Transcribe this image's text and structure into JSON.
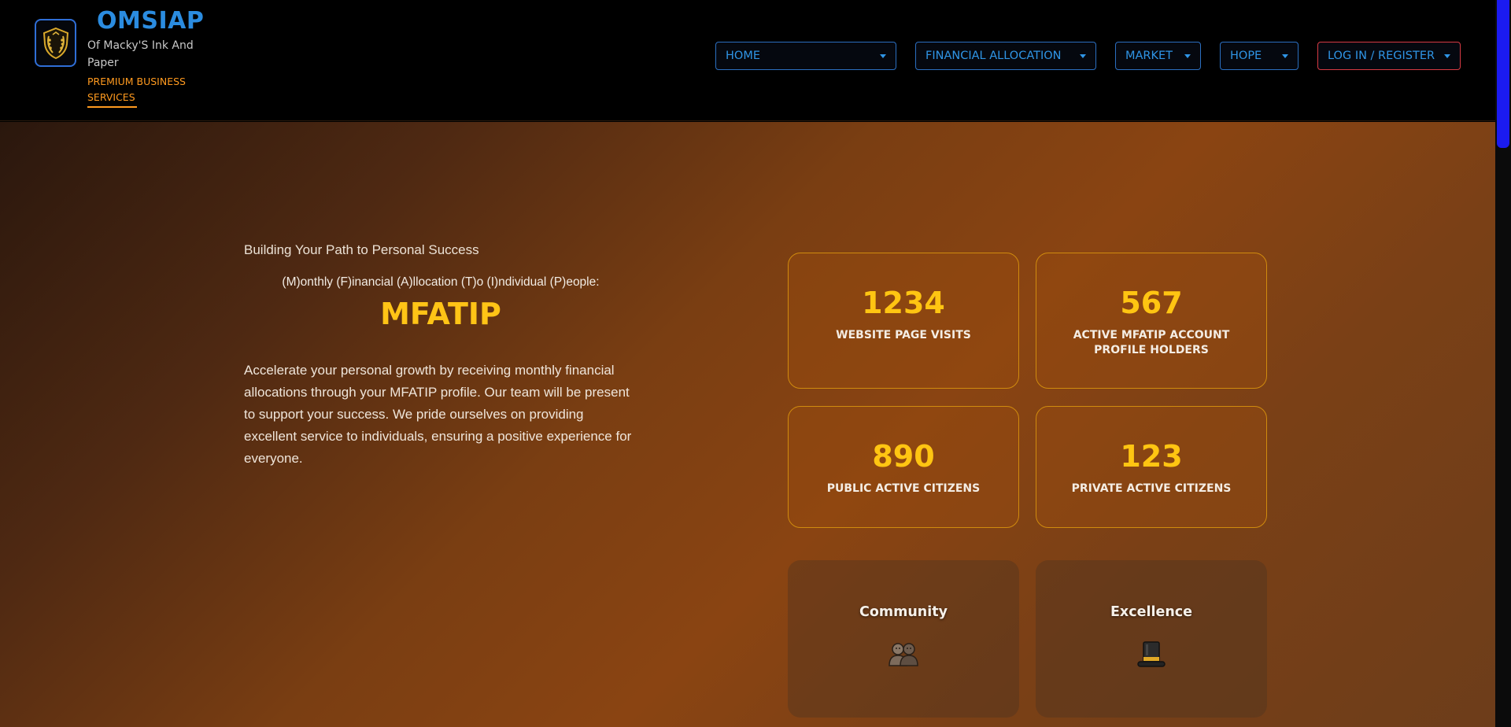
{
  "header": {
    "brand_title": "OMSIAP",
    "brand_subtitle": "Of Macky'S Ink And Paper",
    "brand_tagline": "PREMIUM BUSINESS SERVICES",
    "logo_icon": "shield-laurel-icon",
    "nav": [
      {
        "label": "HOME"
      },
      {
        "label": "FINANCIAL ALLOCATION"
      },
      {
        "label": "MARKET"
      },
      {
        "label": "HOPE"
      },
      {
        "label": "LOG IN / REGISTER"
      }
    ]
  },
  "hero": {
    "tagline": "Building Your Path to Personal Success",
    "acronym": "(M)onthly (F)inancial (A)llocation (T)o (I)ndividual (P)eople:",
    "title": "MFATIP",
    "body": "Accelerate your personal growth by receiving monthly financial allocations through your MFATIP profile. Our team will be present to support your success. We pride ourselves on providing excellent service to individuals, ensuring a positive experience for everyone."
  },
  "stats": [
    {
      "value": "1234",
      "label": "WEBSITE PAGE VISITS"
    },
    {
      "value": "567",
      "label": "ACTIVE MFATIP ACCOUNT PROFILE HOLDERS"
    },
    {
      "value": "890",
      "label": "PUBLIC ACTIVE CITIZENS"
    },
    {
      "value": "123",
      "label": "PRIVATE ACTIVE CITIZENS"
    }
  ],
  "values": [
    {
      "title": "Community",
      "icon": "people-icon"
    },
    {
      "title": "Excellence",
      "icon": "top-hat-icon"
    }
  ],
  "colors": {
    "brand_blue": "#2b8ce0",
    "accent_orange": "#ff9a1f",
    "stat_gold": "#ffc512",
    "login_border": "#d63a43"
  }
}
